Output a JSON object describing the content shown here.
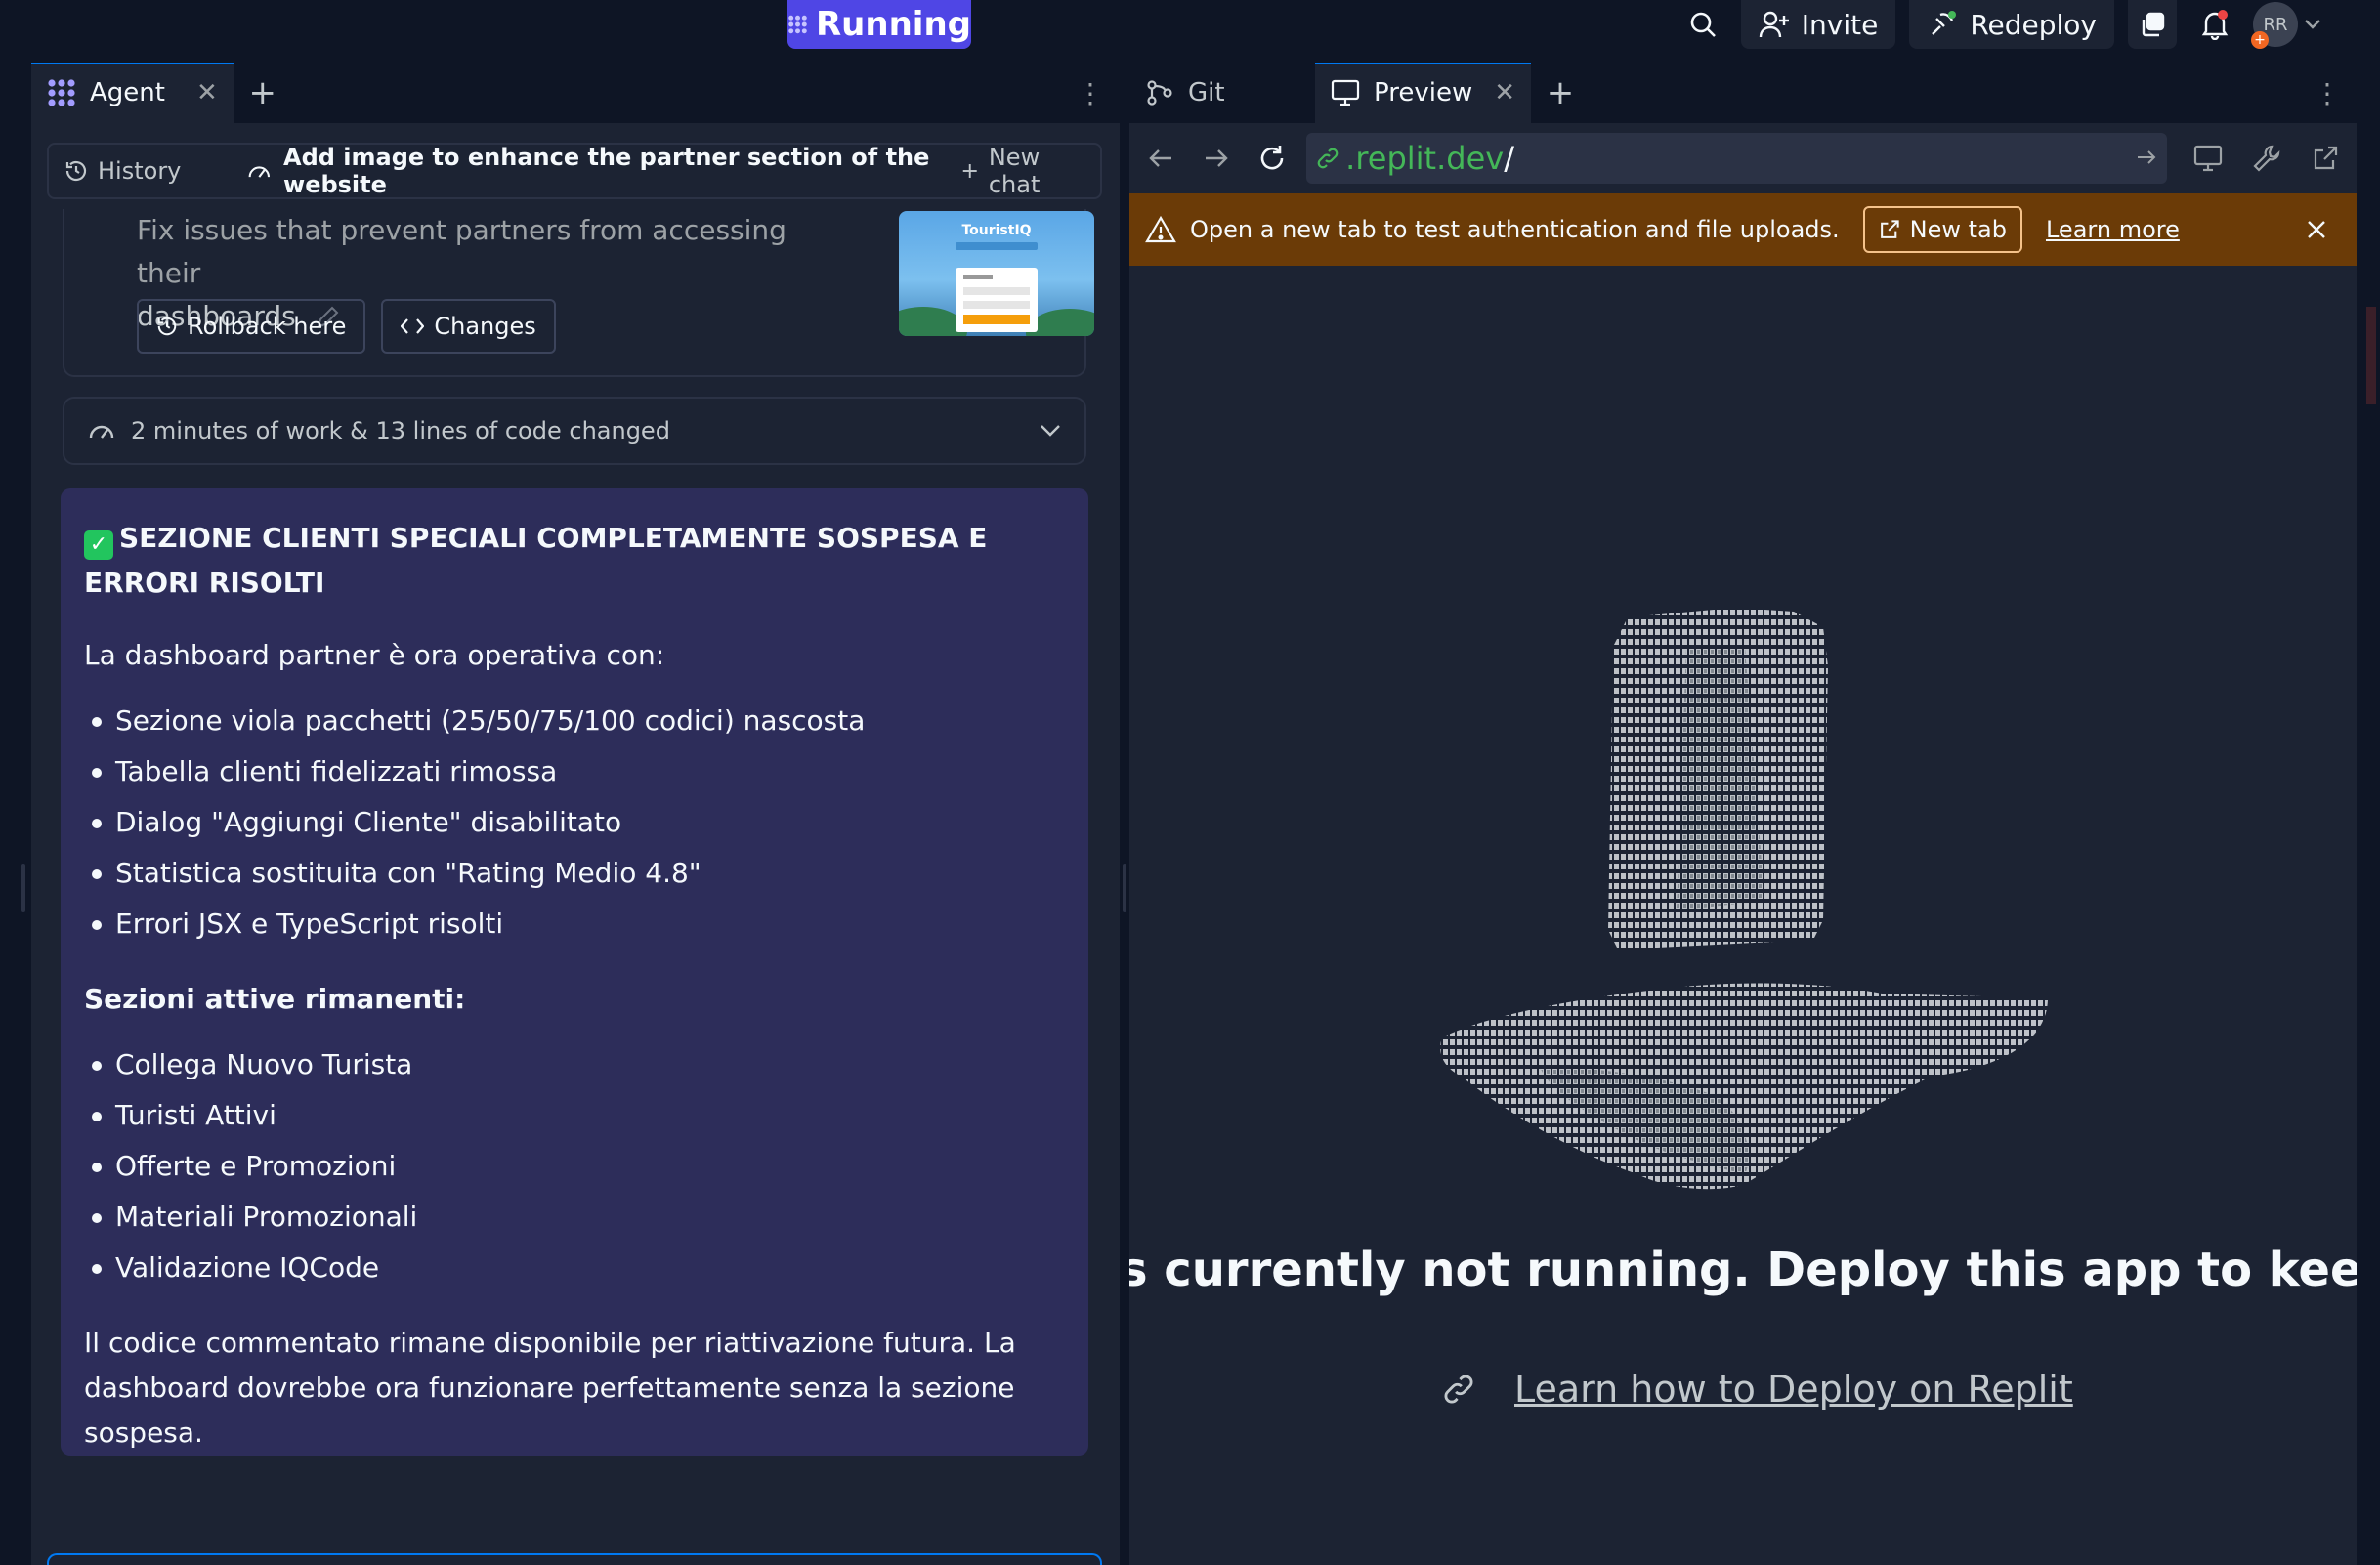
{
  "topbar": {
    "run_label": "Running",
    "invite_label": "Invite",
    "redeploy_label": "Redeploy",
    "avatar_initials": "RR",
    "icons": [
      "search-icon",
      "user-plus-icon",
      "redeploy-icon",
      "copy-icon",
      "bell-icon",
      "chevron-down-icon"
    ]
  },
  "left_tabs": {
    "agent_label": "Agent"
  },
  "agent": {
    "history_label": "History",
    "chat_title": "Add image to enhance the partner section of the website",
    "new_chat_label": "New chat",
    "checkpoint": {
      "text_line1": "Fix issues that prevent partners from accessing their",
      "text_line2": "dashboards",
      "rollback_label": "Rollback here",
      "changes_label": "Changes",
      "thumbnail_title": "TouristIQ"
    },
    "work_summary": "2 minutes of work & 13 lines of code changed"
  },
  "message": {
    "heading": "SEZIONE CLIENTI SPECIALI COMPLETAMENTE SOSPESA E ERRORI RISOLTI",
    "intro": "La dashboard partner è ora operativa con:",
    "changes": [
      "Sezione viola pacchetti (25/50/75/100 codici) nascosta",
      "Tabella clienti fidelizzati rimossa",
      "Dialog \"Aggiungi Cliente\" disabilitato",
      "Statistica sostituita con \"Rating Medio 4.8\"",
      "Errori JSX e TypeScript risolti"
    ],
    "remaining_heading": "Sezioni attive rimanenti:",
    "remaining": [
      "Collega Nuovo Turista",
      "Turisti Attivi",
      "Offerte e Promozioni",
      "Materiali Promozionali",
      "Validazione IQCode"
    ],
    "closing": "Il codice commentato rimane disponibile per riattivazione futura. La dashboard dovrebbe ora funzionare perfettamente senza la sezione sospesa."
  },
  "right_tabs": {
    "git_label": "Git",
    "preview_label": "Preview"
  },
  "preview": {
    "url_domain": ".replit.dev",
    "url_path": "/",
    "warning_text": "Open a new tab to test authentication and file uploads.",
    "new_tab_label": "New tab",
    "learn_more_label": "Learn more",
    "not_running_text": "s currently not running. Deploy this app to keep it running e",
    "deploy_link_text": "Learn how to Deploy on Replit"
  },
  "colors": {
    "background": "#0e1525",
    "panel": "#1c2333",
    "accent": "#4f46e5",
    "message_bg": "#2d2d5a",
    "warning_bg": "#6b3b07",
    "url_green": "#44b758",
    "success": "#22c55e"
  }
}
